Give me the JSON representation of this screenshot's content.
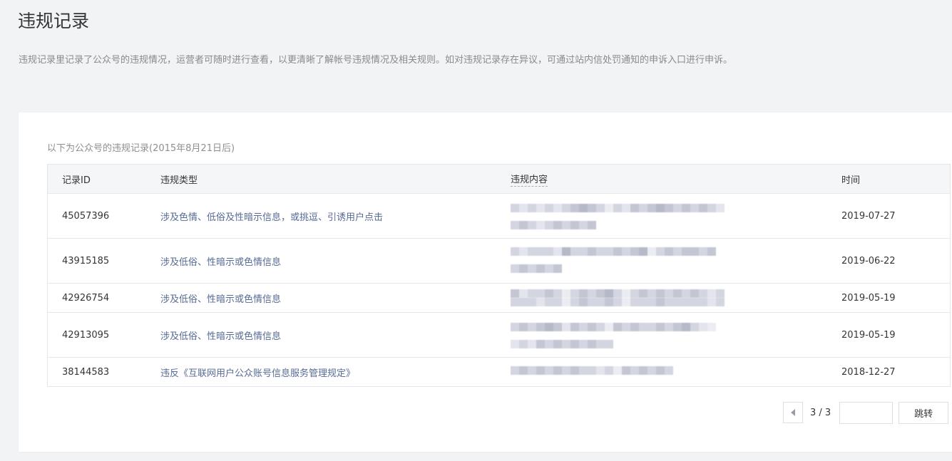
{
  "page": {
    "title": "违规记录",
    "description": "违规记录里记录了公众号的违规情况，运营者可随时进行查看，以更清晰了解帐号违规情况及相关规则。如对违规记录存在异议，可通过站内信处罚通知的申诉入口进行申诉。"
  },
  "table": {
    "caption": "以下为公众号的违规记录(2015年8月21日后)",
    "columns": [
      "记录ID",
      "违规类型",
      "违规内容",
      "时间"
    ],
    "rows": [
      {
        "id": "45057396",
        "type": "涉及色情、低俗及性暗示信息，或挑逗、引诱用户点击",
        "time": "2019-07-27"
      },
      {
        "id": "43915185",
        "type": "涉及低俗、性暗示或色情信息",
        "time": "2019-06-22"
      },
      {
        "id": "42926754",
        "type": "涉及低俗、性暗示或色情信息",
        "time": "2019-05-19"
      },
      {
        "id": "42913095",
        "type": "涉及低俗、性暗示或色情信息",
        "time": "2019-05-19"
      },
      {
        "id": "38144583",
        "type": "违反《互联网用户公众账号信息服务管理规定》",
        "time": "2018-12-27"
      }
    ]
  },
  "pagination": {
    "count": "3 / 3",
    "input_value": "",
    "jump_label": "跳转",
    "prev_icon": "caret-left-icon"
  },
  "colors": {
    "background": "#f2f3f5",
    "link": "#576b95",
    "text": "#353535",
    "muted": "#8a8a8a"
  }
}
